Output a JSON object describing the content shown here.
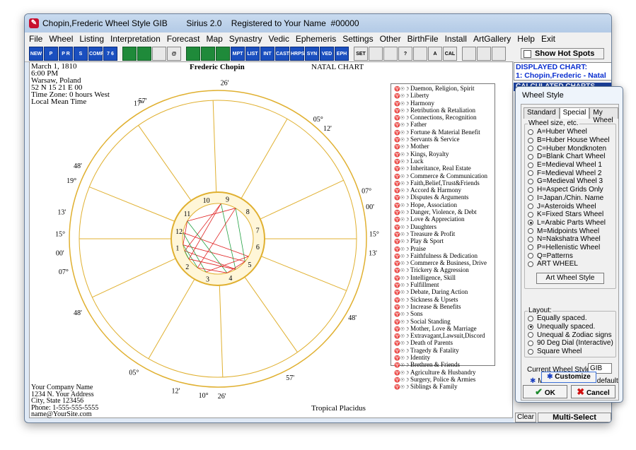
{
  "window": {
    "title": "Chopin,Frederic Wheel Style GIB        Sirius 2.0    Registered to Your Name  #00000"
  },
  "menu": [
    "File",
    "Wheel",
    "Listing",
    "Interpretation",
    "Forecast",
    "Map",
    "Synastry",
    "Vedic",
    "Ephemeris",
    "Settings",
    "Other",
    "BirthFile",
    "Install",
    "ArtGallery",
    "Help",
    "Exit"
  ],
  "toolbar": {
    "buttons": [
      "NEW",
      "P",
      "P R",
      "S",
      "COMP",
      "7 6",
      "",
      "",
      "",
      "@",
      "",
      "",
      "",
      "MPT",
      "LIST",
      "INT",
      "CAST",
      "HRPS",
      "SYN",
      "VED",
      "EPH",
      "SET",
      "",
      "",
      "?",
      "",
      "A",
      "CAL",
      "",
      "",
      ""
    ]
  },
  "chart": {
    "birth_info": [
      "March 1, 1810",
      "6:00 PM",
      "Warsaw, Poland",
      "52 N 15    21 E 00",
      "Time Zone: 0 hours West",
      "Local Mean Time"
    ],
    "name": "Frederic Chopin",
    "type_label": "NATAL CHART",
    "house_system": "Tropical Placidus",
    "company": [
      "Your Company Name",
      "1234 N. Your Address",
      "City, State 123456",
      "Phone: 1-555-555-5555",
      "name@YourSite.com"
    ],
    "wheel_labels": [
      "26'",
      "05°",
      "12'",
      "07°",
      "00'",
      "15°",
      "13'",
      "48'",
      "57'",
      "26'",
      "10°",
      "12'",
      "05°",
      "48'",
      "07°",
      "00'",
      "15°",
      "13'",
      "19°",
      "48'",
      "17°",
      "57'"
    ],
    "house_numbers": [
      "1",
      "2",
      "3",
      "4",
      "5",
      "6",
      "7",
      "8",
      "9",
      "10",
      "11",
      "12"
    ],
    "parts": [
      "Daemon, Religion, Spirit",
      "Liberty",
      "Harmony",
      "Retribution & Retaliation",
      "Connections, Recognition",
      "Father",
      "Fortune & Material Benefit",
      "Servants & Service",
      "Mother",
      "Kings, Royalty",
      "Luck",
      "Inheritance, Real Estate",
      "Commerce & Communication",
      "Faith,Belief,Trust&Friends",
      "Accord & Harmony",
      "Disputes & Arguments",
      "Hope, Association",
      "Danger, Violence, & Debt",
      "Love & Appreciation",
      "Daughters",
      "Treasure & Profit",
      "Play & Sport",
      "Praise",
      "Faithfulness & Dedication",
      "Commerce & Business, Drive",
      "Trickery & Aggression",
      "Intelligence, Skill",
      "Fulfillment",
      "Debate, Daring Action",
      "Sickness & Upsets",
      "Increase & Benefits",
      "Sons",
      "Social Standing",
      "Mother, Love & Marriage",
      "Extravagant,Lawsuit,Discord",
      "Death of Parents",
      "Tragedy & Fatality",
      "Identity",
      "Brethren & Friends",
      "Agriculture & Husbandry",
      "Surgery, Police & Armies",
      "Siblings & Family"
    ]
  },
  "right_panel": {
    "hot_spots": "Show Hot Spots",
    "displayed_label": "DISPLAYED CHART:",
    "displayed_value": "1: Chopin,Frederic - Natal",
    "calc_header": "CALCULATED CHARTS",
    "clear": "Clear",
    "multi_select": "Multi-Select"
  },
  "dialog": {
    "title": "Wheel Style",
    "tabs": [
      "Standard",
      "Special",
      "My Wheel"
    ],
    "size_group": "Wheel size, etc.",
    "options": [
      "A=Huber Wheel",
      "B=Huber House Wheel",
      "C=Huber Mondknoten",
      "D=Blank Chart Wheel",
      "E=Medieval Wheel 1",
      "F=Medieval Wheel 2",
      "G=Medieval Wheel 3",
      "H=Aspect Grids Only",
      "I=Japan./Chin. Name",
      "J=Asteroids Wheel",
      "K=Fixed Stars Wheel",
      "L=Arabic Parts Wheel",
      "M=Midpoints Wheel",
      "N=Nakshatra Wheel",
      "P=Hellenistic Wheel",
      "Q=Patterns",
      "ART WHEEL"
    ],
    "selected_option": "L=Arabic Parts Wheel",
    "art_button": "Art Wheel Style",
    "layout_group": "Layout:",
    "layout_options": [
      "Equally spaced.",
      "Unequally spaced.",
      "Unequal & Zodiac signs",
      "90 Deg Dial (Interactive)",
      "Square Wheel"
    ],
    "selected_layout": "Unequally spaced.",
    "current_label": "Current Wheel Style:",
    "current_value": "GIB",
    "make_default": "Make this the new default",
    "customize": "Customize",
    "ok": "OK",
    "cancel": "Cancel"
  },
  "colors": {
    "accent_blue": "#0a2fd0",
    "wheel_gold": "#e0b030",
    "aspect_red": "#e02020",
    "aspect_green": "#20a040"
  }
}
